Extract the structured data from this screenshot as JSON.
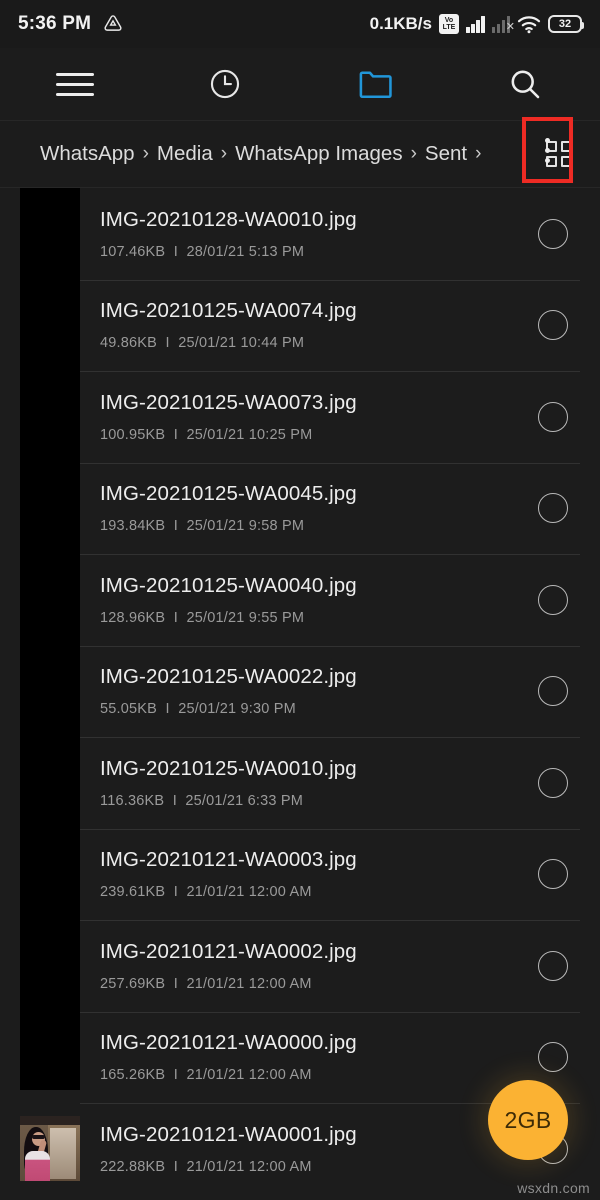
{
  "statusbar": {
    "time": "5:36 PM",
    "drive_icon": "triangle-drive-icon",
    "network_speed": "0.1KB/s",
    "volte_top": "Vo",
    "volte_bottom": "LTE",
    "signal_icon": "signal-bars-icon",
    "nosim_icon": "no-sim-signal-icon",
    "wifi_icon": "wifi-icon",
    "battery_level": "32"
  },
  "toolbar": {
    "menu_icon": "hamburger-menu-icon",
    "recent_icon": "clock-recent-icon",
    "folder_icon": "folder-icon",
    "search_icon": "search-icon",
    "folder_accent": "#2196d9"
  },
  "breadcrumb": {
    "items": [
      "WhatsApp",
      "Media",
      "WhatsApp Images",
      "Sent"
    ],
    "separator": "›",
    "grid_icon": "grid-view-icon",
    "overflow_icon": "overflow-menu-icon",
    "highlight_color": "#ee2b24"
  },
  "files": [
    {
      "name": "IMG-20210128-WA0010.jpg",
      "size": "107.46KB",
      "sep": "I",
      "date": "28/01/21 5:13 PM",
      "thumb": "blank"
    },
    {
      "name": "IMG-20210125-WA0074.jpg",
      "size": "49.86KB",
      "sep": "I",
      "date": "25/01/21 10:44 PM",
      "thumb": "blank"
    },
    {
      "name": "IMG-20210125-WA0073.jpg",
      "size": "100.95KB",
      "sep": "I",
      "date": "25/01/21 10:25 PM",
      "thumb": "blank"
    },
    {
      "name": "IMG-20210125-WA0045.jpg",
      "size": "193.84KB",
      "sep": "I",
      "date": "25/01/21 9:58 PM",
      "thumb": "blank"
    },
    {
      "name": "IMG-20210125-WA0040.jpg",
      "size": "128.96KB",
      "sep": "I",
      "date": "25/01/21 9:55 PM",
      "thumb": "blank"
    },
    {
      "name": "IMG-20210125-WA0022.jpg",
      "size": "55.05KB",
      "sep": "I",
      "date": "25/01/21 9:30 PM",
      "thumb": "blank"
    },
    {
      "name": "IMG-20210125-WA0010.jpg",
      "size": "116.36KB",
      "sep": "I",
      "date": "25/01/21 6:33 PM",
      "thumb": "blank"
    },
    {
      "name": "IMG-20210121-WA0003.jpg",
      "size": "239.61KB",
      "sep": "I",
      "date": "21/01/21 12:00 AM",
      "thumb": "blank"
    },
    {
      "name": "IMG-20210121-WA0002.jpg",
      "size": "257.69KB",
      "sep": "I",
      "date": "21/01/21 12:00 AM",
      "thumb": "blank"
    },
    {
      "name": "IMG-20210121-WA0000.jpg",
      "size": "165.26KB",
      "sep": "I",
      "date": "21/01/21 12:00 AM",
      "thumb": "blank"
    },
    {
      "name": "IMG-20210121-WA0001.jpg",
      "size": "222.88KB",
      "sep": "I",
      "date": "21/01/21 12:00 AM",
      "thumb": "photo"
    }
  ],
  "fab": {
    "label": "2GB",
    "color": "#fbb233"
  },
  "watermark": "wsxdn.com"
}
